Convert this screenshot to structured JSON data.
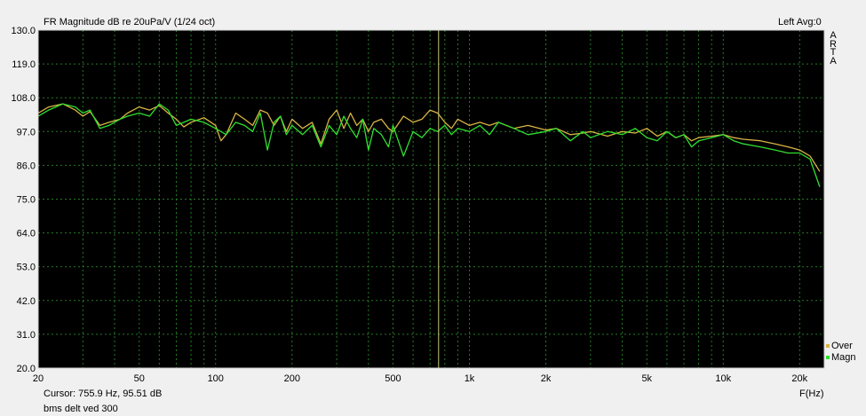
{
  "header": {
    "title": "FR Magnitude dB re 20uPa/V (1/24 oct)",
    "channel_info": "Left  Avg:0"
  },
  "brand": [
    "A",
    "R",
    "T",
    "A"
  ],
  "footer": {
    "cursor": "Cursor:  755.9 Hz, 95.51 dB",
    "caption": "bms delt ved 300",
    "x_unit": "F(Hz)"
  },
  "colors": {
    "plot_bg": "#000000",
    "grid": "#2f9a2f",
    "frame": "#cfcfcf",
    "cursor": "#c8c87a",
    "over": "#d8b444",
    "magn": "#2fe02f"
  },
  "chart_data": {
    "type": "line",
    "title": "FR Magnitude dB re 20uPa/V (1/24 oct)",
    "xlabel": "F(Hz)",
    "ylabel": "",
    "x_scale": "log",
    "xlim": [
      20,
      25000
    ],
    "ylim": [
      20.0,
      130.0
    ],
    "y_ticks": [
      "130.0",
      "119.0",
      "108.0",
      "97.0",
      "86.0",
      "75.0",
      "64.0",
      "53.0",
      "42.0",
      "31.0",
      "20.0"
    ],
    "x_ticks": [
      {
        "value": 20,
        "label": "20"
      },
      {
        "value": 50,
        "label": "50"
      },
      {
        "value": 100,
        "label": "100"
      },
      {
        "value": 200,
        "label": "200"
      },
      {
        "value": 500,
        "label": "500"
      },
      {
        "value": 1000,
        "label": "1k"
      },
      {
        "value": 2000,
        "label": "2k"
      },
      {
        "value": 5000,
        "label": "5k"
      },
      {
        "value": 10000,
        "label": "10k"
      },
      {
        "value": 20000,
        "label": "20k"
      }
    ],
    "grid": true,
    "legend_position": "bottom-right",
    "cursor": {
      "freq": 755.9,
      "db": 95.51
    },
    "series": [
      {
        "name": "Over",
        "color": "#d8b444",
        "x": [
          20,
          22,
          25,
          28,
          30,
          32,
          35,
          38,
          42,
          45,
          50,
          55,
          60,
          65,
          70,
          75,
          80,
          90,
          100,
          105,
          110,
          120,
          130,
          140,
          150,
          160,
          170,
          180,
          190,
          200,
          220,
          240,
          260,
          280,
          300,
          320,
          340,
          360,
          380,
          400,
          420,
          450,
          480,
          500,
          550,
          600,
          650,
          700,
          750,
          800,
          850,
          900,
          1000,
          1100,
          1200,
          1300,
          1500,
          1700,
          2000,
          2200,
          2500,
          2800,
          3000,
          3500,
          4000,
          4500,
          5000,
          5500,
          6000,
          6500,
          7000,
          7500,
          8000,
          9000,
          10000,
          11000,
          12000,
          14000,
          16000,
          18000,
          20000,
          22000,
          24000
        ],
        "y": [
          103,
          105,
          106,
          104,
          102,
          103.5,
          99,
          100,
          101,
          103,
          105,
          104,
          105.5,
          103,
          101,
          98.5,
          100,
          101.5,
          99,
          94,
          96,
          103,
          101,
          99,
          104,
          103,
          99,
          102,
          97,
          101,
          98,
          100,
          93,
          101,
          104,
          98,
          103,
          99,
          101,
          97,
          100,
          101,
          98,
          97,
          102,
          100,
          101,
          104,
          103,
          100,
          98,
          101,
          99,
          100,
          99,
          100,
          98,
          99,
          97.5,
          98,
          96,
          96.5,
          97,
          95.5,
          97,
          96.5,
          98,
          95.5,
          97,
          95,
          96,
          94,
          95,
          95.5,
          96,
          95,
          94.5,
          94,
          93,
          92,
          91,
          89,
          84
        ]
      },
      {
        "name": "Magn",
        "color": "#2fe02f",
        "x": [
          20,
          22,
          25,
          28,
          30,
          32,
          35,
          38,
          42,
          45,
          50,
          55,
          60,
          65,
          70,
          75,
          80,
          90,
          100,
          105,
          110,
          120,
          130,
          140,
          150,
          160,
          170,
          180,
          190,
          200,
          220,
          240,
          260,
          280,
          300,
          320,
          340,
          360,
          380,
          400,
          420,
          450,
          480,
          500,
          550,
          600,
          650,
          700,
          750,
          800,
          850,
          900,
          1000,
          1100,
          1200,
          1300,
          1500,
          1700,
          2000,
          2200,
          2500,
          2800,
          3000,
          3500,
          4000,
          4500,
          5000,
          5500,
          6000,
          6500,
          7000,
          7500,
          8000,
          9000,
          10000,
          11000,
          12000,
          14000,
          16000,
          18000,
          20000,
          22000,
          24000
        ],
        "y": [
          102,
          104,
          106,
          105,
          103,
          104,
          98,
          99,
          101,
          102,
          103,
          102,
          106,
          104,
          99,
          100,
          101,
          100,
          98,
          97,
          96,
          100,
          99,
          97,
          103,
          91,
          100,
          102,
          96,
          99,
          96,
          99,
          92,
          99,
          96,
          102,
          98,
          95,
          101,
          91,
          98,
          96,
          92,
          99,
          89,
          97,
          95,
          98,
          97,
          99,
          96,
          98,
          97,
          99,
          96,
          100,
          98,
          96,
          97,
          98,
          94,
          97,
          95,
          97,
          96,
          98,
          95,
          94,
          97,
          95,
          96,
          92,
          94,
          95,
          96,
          94,
          93,
          92,
          91,
          90,
          90,
          88,
          79
        ]
      }
    ]
  }
}
